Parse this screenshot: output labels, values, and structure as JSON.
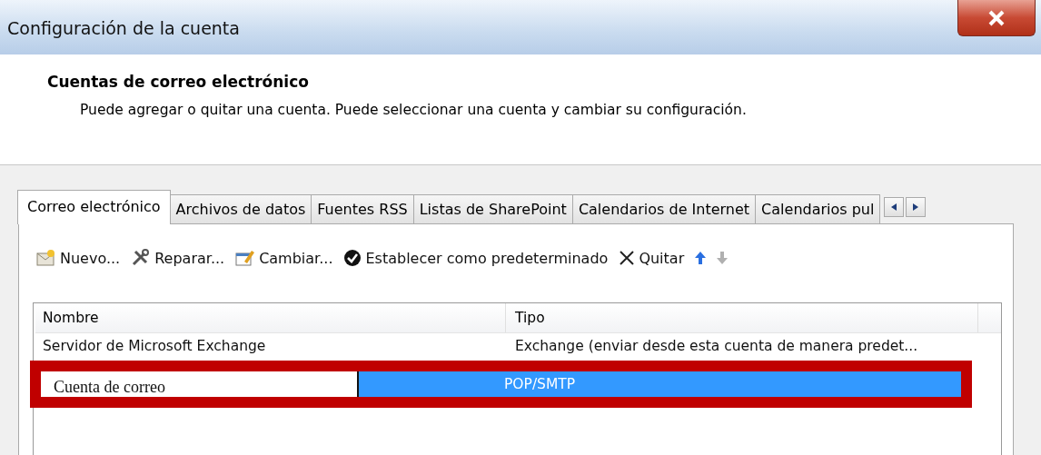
{
  "window": {
    "title": "Configuración de la cuenta"
  },
  "header": {
    "title": "Cuentas de correo electrónico",
    "description": "Puede agregar o quitar una cuenta. Puede seleccionar una cuenta y cambiar su configuración."
  },
  "tabs": [
    {
      "label": "Correo electrónico",
      "selected": true
    },
    {
      "label": "Archivos de datos",
      "selected": false
    },
    {
      "label": "Fuentes RSS",
      "selected": false
    },
    {
      "label": "Listas de SharePoint",
      "selected": false
    },
    {
      "label": "Calendarios de Internet",
      "selected": false
    },
    {
      "label": "Calendarios pul",
      "selected": false
    }
  ],
  "toolbar": [
    {
      "kind": "new",
      "label": "Nuevo...",
      "disabled": false
    },
    {
      "kind": "repair",
      "label": "Reparar...",
      "disabled": false
    },
    {
      "kind": "change",
      "label": "Cambiar...",
      "disabled": false
    },
    {
      "kind": "default",
      "label": "Establecer como predeterminado",
      "disabled": false
    },
    {
      "kind": "remove",
      "label": "Quitar",
      "disabled": false
    },
    {
      "kind": "up",
      "disabled": false
    },
    {
      "kind": "down",
      "disabled": true
    }
  ],
  "table": {
    "columns": [
      "Nombre",
      "Tipo"
    ],
    "rows": [
      {
        "name": "Servidor de Microsoft Exchange",
        "type": "Exchange (enviar desde esta cuenta de manera predet...",
        "selected": false,
        "highlighted": false
      },
      {
        "name": "Cuenta de correo",
        "type": "POP/SMTP",
        "selected": true,
        "highlighted": true
      }
    ]
  }
}
